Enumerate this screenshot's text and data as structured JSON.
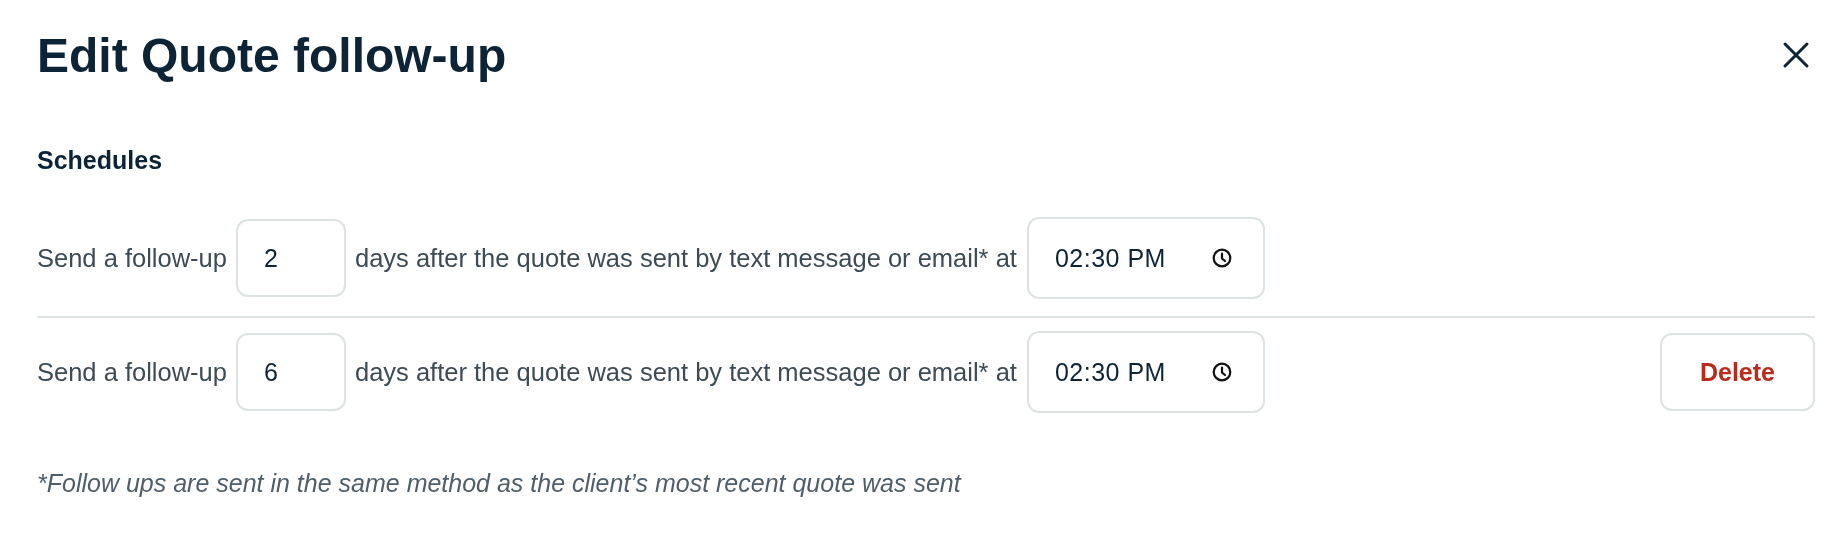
{
  "dialog": {
    "title": "Edit Quote follow-up"
  },
  "section_title": "Schedules",
  "schedules": [
    {
      "prefix": "Send a follow-up",
      "days": "2",
      "middle": "days after the quote was sent by text message or email* at",
      "time": "02:30 PM"
    },
    {
      "prefix": "Send a follow-up",
      "days": "6",
      "middle": "days after the quote was sent by text message or email* at",
      "time": "02:30 PM",
      "delete_label": "Delete"
    }
  ],
  "footnote": "*Follow ups are sent in the same method as the client’s most recent quote was sent"
}
